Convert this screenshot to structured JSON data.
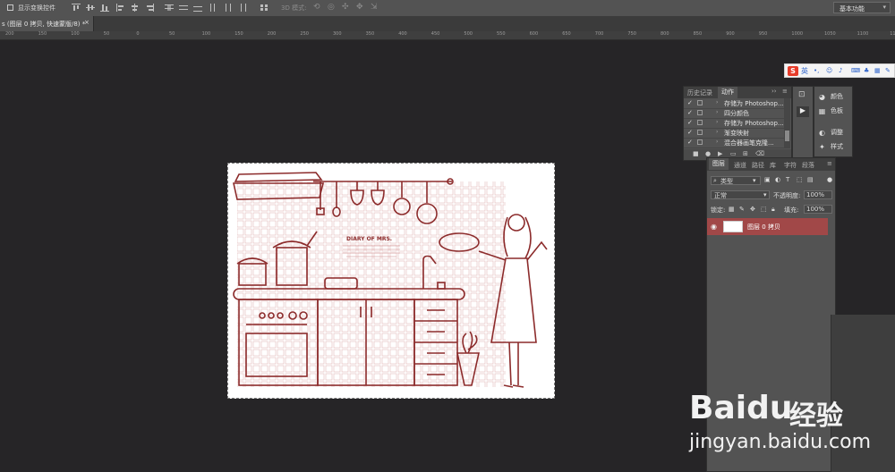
{
  "options_bar": {
    "show_transform_label": "显示变换控件",
    "mode_3d_label": "3D 模式:",
    "workspace": "基本功能"
  },
  "document_tab": {
    "title": "s (图层 0 拷贝, 快速蒙版/8) *",
    "close": "×"
  },
  "ruler": {
    "ticks": [
      "200",
      "150",
      "100",
      "50",
      "0",
      "50",
      "100",
      "150",
      "200",
      "250",
      "300",
      "350",
      "400",
      "450",
      "500",
      "550",
      "600",
      "650",
      "700",
      "750",
      "800",
      "850",
      "900",
      "950",
      "1000",
      "1050",
      "1100",
      "1150"
    ]
  },
  "ime": {
    "logo": "S",
    "mode": "英"
  },
  "history_panel": {
    "tabs": [
      "历史记录",
      "动作"
    ],
    "active_tab": "动作",
    "actions": [
      {
        "checked": true,
        "label": "存储为 Photoshop..."
      },
      {
        "checked": true,
        "label": "四分颜色"
      },
      {
        "checked": true,
        "label": "存储为 Photoshop..."
      },
      {
        "checked": true,
        "label": "渐变映射"
      },
      {
        "checked": true,
        "label": "混合器画笔克隆..."
      }
    ]
  },
  "mini_panel": {
    "items": [
      {
        "icon": "color-icon",
        "label": "颜色"
      },
      {
        "icon": "swatches-icon",
        "label": "色板"
      },
      {
        "icon": "adjustments-icon",
        "label": "调整"
      },
      {
        "icon": "styles-icon",
        "label": "样式"
      }
    ]
  },
  "layers_panel": {
    "tabs": [
      "图层",
      "通道",
      "路径",
      "库",
      "字符",
      "段落"
    ],
    "filter_kind": "类型",
    "blend_mode": "正常",
    "opacity_label": "不透明度:",
    "opacity_value": "100%",
    "lock_label": "锁定:",
    "fill_label": "填充:",
    "fill_value": "100%",
    "layers": [
      {
        "name": "图层 0 拷贝",
        "visible": true,
        "selected": true
      }
    ]
  },
  "watermark": {
    "brand": "Bai",
    "brand2": "du",
    "cn": "经验",
    "url": "jingyan.baidu.com"
  },
  "colors": {
    "selected_layer": "#a14848",
    "illustration_line": "#8c2b2b",
    "ime_red": "#e63c2a"
  }
}
